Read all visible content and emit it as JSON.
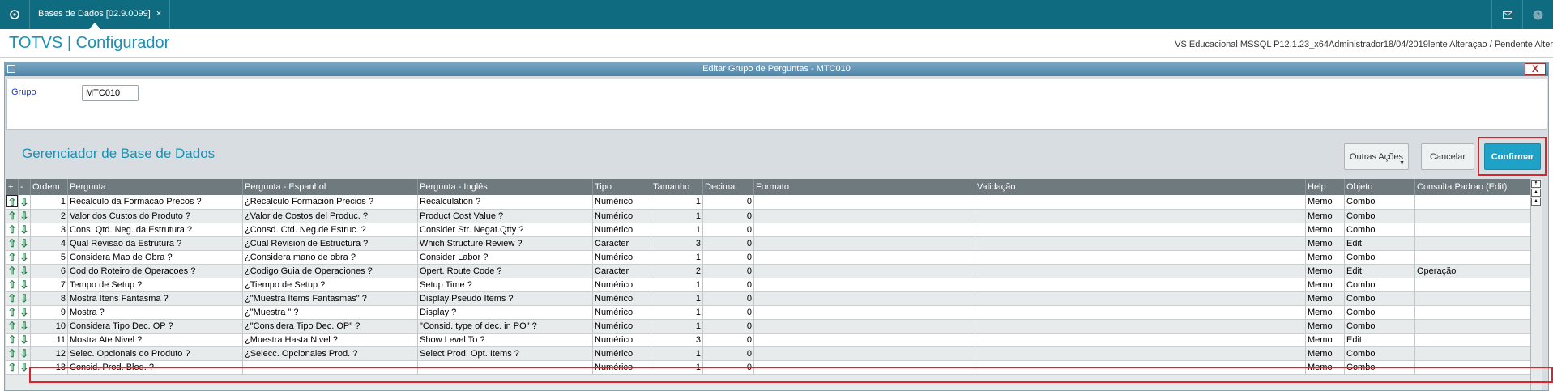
{
  "topbar": {
    "tab_label": "Bases de Dados [02.9.0099]",
    "tab_close": "×",
    "home_icon": "home-icon",
    "mail_icon": "mail-icon",
    "help_icon": "help-icon"
  },
  "titlebar": {
    "app_title": "TOTVS | Configurador",
    "env_info": "VS Educacional MSSQL P12.1.23_x64Administrador18/04/2019lente Alteraçao / Pendente Alter"
  },
  "dialog": {
    "title": "Editar Grupo de Perguntas - MTC010",
    "close": "X",
    "group_label": "Grupo",
    "group_value": "MTC010",
    "manager_title": "Gerenciador de Base de Dados",
    "buttons": {
      "outras": "Outras Ações",
      "cancelar": "Cancelar",
      "confirmar": "Confirmar"
    }
  },
  "grid": {
    "columns": {
      "plus": "+",
      "minus": "-",
      "ordem": "Ordem",
      "pergunta": "Pergunta",
      "pergunta_es": "Pergunta - Espanhol",
      "pergunta_en": "Pergunta - Inglês",
      "tipo": "Tipo",
      "tamanho": "Tamanho",
      "decimal": "Decimal",
      "formato": "Formato",
      "validacao": "Validação",
      "help": "Help",
      "objeto": "Objeto",
      "consulta": "Consulta Padrao (Edit)"
    },
    "rows": [
      {
        "ordem": "1",
        "pergunta": "Recalculo da Formacao Precos ?",
        "es": "¿Recalculo Formacion Precios ?",
        "en": "Recalculation ?",
        "tipo": "Numérico",
        "tamanho": "1",
        "decimal": "0",
        "formato": "",
        "validacao": "",
        "help": "Memo",
        "objeto": "Combo",
        "consulta": ""
      },
      {
        "ordem": "2",
        "pergunta": "Valor dos Custos do Produto ?",
        "es": "¿Valor de Costos del Produc. ?",
        "en": "Product Cost Value ?",
        "tipo": "Numérico",
        "tamanho": "1",
        "decimal": "0",
        "formato": "",
        "validacao": "",
        "help": "Memo",
        "objeto": "Combo",
        "consulta": ""
      },
      {
        "ordem": "3",
        "pergunta": "Cons. Qtd. Neg. da Estrutura ?",
        "es": "¿Consd. Ctd. Neg.de Estruc. ?",
        "en": "Consider Str. Negat.Qtty ?",
        "tipo": "Numérico",
        "tamanho": "1",
        "decimal": "0",
        "formato": "",
        "validacao": "",
        "help": "Memo",
        "objeto": "Combo",
        "consulta": ""
      },
      {
        "ordem": "4",
        "pergunta": "Qual Revisao da Estrutura ?",
        "es": "¿Cual Revision de Estructura ?",
        "en": "Which Structure Review ?",
        "tipo": "Caracter",
        "tamanho": "3",
        "decimal": "0",
        "formato": "",
        "validacao": "",
        "help": "Memo",
        "objeto": "Edit",
        "consulta": ""
      },
      {
        "ordem": "5",
        "pergunta": "Considera Mao de Obra ?",
        "es": "¿Considera mano de obra ?",
        "en": "Consider Labor ?",
        "tipo": "Numérico",
        "tamanho": "1",
        "decimal": "0",
        "formato": "",
        "validacao": "",
        "help": "Memo",
        "objeto": "Combo",
        "consulta": ""
      },
      {
        "ordem": "6",
        "pergunta": "Cod do Roteiro de Operacoes ?",
        "es": "¿Codigo Guia de Operaciones ?",
        "en": "Opert. Route Code ?",
        "tipo": "Caracter",
        "tamanho": "2",
        "decimal": "0",
        "formato": "",
        "validacao": "",
        "help": "Memo",
        "objeto": "Edit",
        "consulta": "Operação"
      },
      {
        "ordem": "7",
        "pergunta": "Tempo de Setup ?",
        "es": "¿Tiempo de Setup ?",
        "en": "Setup Time ?",
        "tipo": "Numérico",
        "tamanho": "1",
        "decimal": "0",
        "formato": "",
        "validacao": "",
        "help": "Memo",
        "objeto": "Combo",
        "consulta": ""
      },
      {
        "ordem": "8",
        "pergunta": "Mostra Itens Fantasma ?",
        "es": "¿\"Muestra Items Fantasmas\" ?",
        "en": "Display Pseudo Items ?",
        "tipo": "Numérico",
        "tamanho": "1",
        "decimal": "0",
        "formato": "",
        "validacao": "",
        "help": "Memo",
        "objeto": "Combo",
        "consulta": ""
      },
      {
        "ordem": "9",
        "pergunta": "Mostra ?",
        "es": "¿\"Muestra \" ?",
        "en": "Display ?",
        "tipo": "Numérico",
        "tamanho": "1",
        "decimal": "0",
        "formato": "",
        "validacao": "",
        "help": "Memo",
        "objeto": "Combo",
        "consulta": ""
      },
      {
        "ordem": "10",
        "pergunta": "Considera Tipo Dec. OP ?",
        "es": "¿\"Considera Tipo Dec. OP\" ?",
        "en": "\"Consid. type of dec. in PO\" ?",
        "tipo": "Numérico",
        "tamanho": "1",
        "decimal": "0",
        "formato": "",
        "validacao": "",
        "help": "Memo",
        "objeto": "Combo",
        "consulta": ""
      },
      {
        "ordem": "11",
        "pergunta": "Mostra Ate Nivel ?",
        "es": "¿Muestra Hasta Nivel ?",
        "en": "Show Level To ?",
        "tipo": "Numérico",
        "tamanho": "3",
        "decimal": "0",
        "formato": "",
        "validacao": "",
        "help": "Memo",
        "objeto": "Edit",
        "consulta": ""
      },
      {
        "ordem": "12",
        "pergunta": "Selec. Opcionais do Produto ?",
        "es": "¿Selecc. Opcionales Prod. ?",
        "en": "Select Prod. Opt. Items ?",
        "tipo": "Numérico",
        "tamanho": "1",
        "decimal": "0",
        "formato": "",
        "validacao": "",
        "help": "Memo",
        "objeto": "Combo",
        "consulta": ""
      },
      {
        "ordem": "13",
        "pergunta": "Consid. Prod. Bloq. ?",
        "es": "",
        "en": "",
        "tipo": "Numérico",
        "tamanho": "1",
        "decimal": "0",
        "formato": "",
        "validacao": "",
        "help": "Memo",
        "objeto": "Combo",
        "consulta": ""
      }
    ]
  }
}
